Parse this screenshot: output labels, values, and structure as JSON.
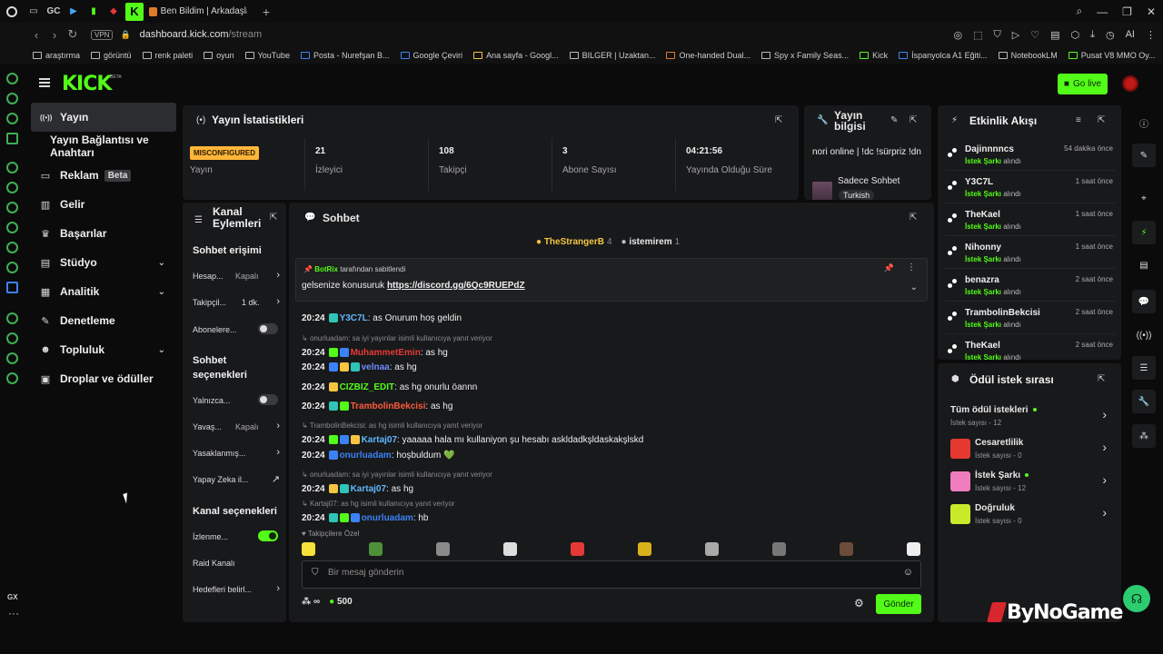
{
  "browser": {
    "tabs": [
      "GC",
      "Ben Bildim | Arkadaşlarınla"
    ],
    "url_host": "dashboard.kick.com",
    "url_path": "/stream",
    "vpn": "VPN",
    "ai_label": "AI",
    "bookmarks": [
      "araştırma",
      "görüntü",
      "renk paleti",
      "oyun",
      "YouTube",
      "Posta - Nurefşan B...",
      "Google Çeviri",
      "Ana sayfa - Googl...",
      "BILGER | Uzaktan...",
      "One-handed Dual...",
      "Spy x Family Seas...",
      "Kick",
      "İspanyolca A1 Eğiti...",
      "NotebookLM",
      "Pusat V8 MMO Oy..."
    ],
    "sidebar_gx": "GX"
  },
  "header": {
    "logo": "KICK",
    "logo_badge": "BETA",
    "go_live": "Go live"
  },
  "nav": {
    "items": [
      {
        "label": "Yayın",
        "icon": "broadcast-icon",
        "glyph": "((•))"
      },
      {
        "label": "Yayın Bağlantısı ve Anahtarı",
        "icon": "",
        "glyph": ""
      },
      {
        "label": "Reklam",
        "icon": "ad-icon",
        "glyph": "▭",
        "badge": "Beta"
      },
      {
        "label": "Gelir",
        "icon": "revenue-icon",
        "glyph": "▥"
      },
      {
        "label": "Başarılar",
        "icon": "trophy-icon",
        "glyph": "🏆"
      },
      {
        "label": "Stüdyo",
        "icon": "studio-icon",
        "glyph": "▤"
      },
      {
        "label": "Analitik",
        "icon": "analytics-icon",
        "glyph": "▦"
      },
      {
        "label": "Denetleme",
        "icon": "wrench-icon",
        "glyph": "🔧"
      },
      {
        "label": "Topluluk",
        "icon": "community-icon",
        "glyph": "👥"
      },
      {
        "label": "Droplar ve ödüller",
        "icon": "gift-icon",
        "glyph": "🎁"
      }
    ]
  },
  "stats": {
    "title": "Yayın İstatistikleri",
    "status_badge": "MISCONFIGURED",
    "status_label": "Yayın",
    "columns": [
      {
        "value": "21",
        "label": "İzleyici"
      },
      {
        "value": "108",
        "label": "Takipçi"
      },
      {
        "value": "3",
        "label": "Abone Sayısı"
      },
      {
        "value": "04:21:56",
        "label": "Yayında Olduğu Süre"
      }
    ]
  },
  "stream_info": {
    "title": "Yayın bilgisi",
    "text": "nori online | !dc !sürpriz !dn",
    "category": "Sadece Sohbet",
    "tag": "Turkish"
  },
  "events": {
    "title": "Etkinlik Akışı",
    "action_label": "İstek Şarkı",
    "action_suffix": "alındı",
    "items": [
      {
        "name": "Dajinnnncs",
        "time": "54 dakika önce"
      },
      {
        "name": "Y3C7L",
        "time": "1 saat önce"
      },
      {
        "name": "TheKael",
        "time": "1 saat önce"
      },
      {
        "name": "Nihonny",
        "time": "1 saat önce"
      },
      {
        "name": "benazra",
        "time": "2 saat önce"
      },
      {
        "name": "TrambolinBekcisi",
        "time": "2 saat önce"
      },
      {
        "name": "TheKael",
        "time": "2 saat önce"
      }
    ]
  },
  "rewards": {
    "title": "Ödül istek sırası",
    "items": [
      {
        "name": "Tüm ödül istekleri",
        "count": "İstek sayısı - 12",
        "color": "",
        "dot": true
      },
      {
        "name": "Cesaretlilik",
        "count": "İstek sayısı - 0",
        "color": "#e5392f",
        "dot": false
      },
      {
        "name": "İstek Şarkı",
        "count": "İstek sayısı - 12",
        "color": "#f07cc0",
        "dot": true
      },
      {
        "name": "Doğruluk",
        "count": "İstek sayısı - 0",
        "color": "#c9ea2a",
        "dot": false
      }
    ]
  },
  "actions": {
    "title": "Kanal Eylemleri",
    "sections": {
      "chat_access": "Sohbet erişimi",
      "chat_options": "Sohbet seçenekleri",
      "channel_options": "Kanal seçenekleri"
    },
    "rows": {
      "hesap": "Hesap...",
      "hesap_val": "Kapalı",
      "takip": "Takipçil...",
      "takip_val": "1 dk.",
      "abone": "Abonelere...",
      "yalniz": "Yalnızca...",
      "yavas": "Yavaş...",
      "yavas_val": "Kapalı",
      "yasak": "Yasaklanmış...",
      "yapay": "Yapay Zeka il...",
      "izlenme": "İzlenme...",
      "raid": "Raid Kanalı",
      "hedef": "Hedefleri belirl..."
    }
  },
  "chat": {
    "title": "Sohbet",
    "top_users": [
      {
        "name": "TheStrangerB",
        "count": "4"
      },
      {
        "name": "istemirem",
        "count": "1"
      }
    ],
    "pinned_by": "BotRix",
    "pinned_suffix": "tarafından sabitlendi",
    "pinned_text": "gelsenize konusuruk",
    "pinned_link": "https://discord.gg/6Qc9RUEPdZ",
    "messages": [
      {
        "time": "20:24",
        "user": "Y3C7L",
        "color": "#5fb7ff",
        "text": "as Onurum hoş geldin",
        "reply": ""
      },
      {
        "time": "20:24",
        "user": "MuhammetEmin",
        "color": "#e53935",
        "text": "as hg",
        "reply": "onurluadam: sa iyi yayınlar  isimli kullanıcıya yanıt veriyor"
      },
      {
        "time": "20:24",
        "user": "velnaa",
        "color": "#6b8cff",
        "text": "as hg",
        "reply": ""
      },
      {
        "time": "20:24",
        "user": "CIZBIZ_EDIT",
        "color": "#53fc18",
        "text": "as hg onurlu öannn",
        "reply": ""
      },
      {
        "time": "20:24",
        "user": "TrambolinBekcisi",
        "color": "#ff5a3c",
        "text": "as hg",
        "reply": ""
      },
      {
        "time": "20:24",
        "user": "Kartaj07",
        "color": "#5fb7ff",
        "text": "yaaaaa hala mı kullaniyon şu hesabı askldadkşldaskakşlskd",
        "reply": "TrambolinBekcisi: as hg isimli kullanıcıya yanıt veriyor"
      },
      {
        "time": "20:24",
        "user": "onurluadam",
        "color": "#3b82f6",
        "text": "hoşbuldum 💚",
        "reply": ""
      },
      {
        "time": "20:24",
        "user": "Kartaj07",
        "color": "#5fb7ff",
        "text": "as hg",
        "reply": "onurluadam: sa iyi yayınlar  isimli kullanıcıya yanıt veriyor"
      },
      {
        "time": "20:24",
        "user": "onurluadam",
        "color": "#3b82f6",
        "text": "hb",
        "reply": "Kartaj07: as hg isimli kullanıcıya yanıt veriyor"
      }
    ],
    "followers_only": "Takipçilere Özel",
    "input_placeholder": "Bir mesaj gönderin",
    "infinity": "∞",
    "points": "500",
    "send": "Gönder"
  },
  "watermark": "ByNoGame"
}
